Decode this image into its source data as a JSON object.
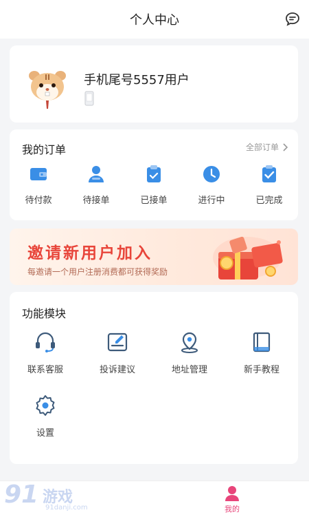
{
  "header": {
    "title": "个人中心",
    "message_icon": "chat-bubble-icon"
  },
  "profile": {
    "username": "手机尾号5557用户",
    "avatar_icon": "hamster-avatar",
    "phone_icon": "phone-icon"
  },
  "orders": {
    "title": "我的订单",
    "view_all": "全部订单",
    "accent": "#3a8ee6",
    "items": [
      {
        "label": "待付款",
        "icon": "wallet-icon"
      },
      {
        "label": "待接单",
        "icon": "user-icon"
      },
      {
        "label": "已接单",
        "icon": "clipboard-icon"
      },
      {
        "label": "进行中",
        "icon": "clock-icon"
      },
      {
        "label": "已完成",
        "icon": "checklist-icon"
      }
    ]
  },
  "banner": {
    "title": "邀请新用户加入",
    "subtitle": "每邀请一个用户注册消费都可获得奖励",
    "title_color": "#e8453a"
  },
  "modules": {
    "title": "功能模块",
    "items": [
      {
        "label": "联系客服",
        "icon": "headset-icon"
      },
      {
        "label": "投诉建议",
        "icon": "edit-icon"
      },
      {
        "label": "地址管理",
        "icon": "location-icon"
      },
      {
        "label": "新手教程",
        "icon": "book-icon"
      },
      {
        "label": "设置",
        "icon": "gear-icon"
      }
    ]
  },
  "tabbar": {
    "mine_label": "我的",
    "active_color": "#e8457a"
  },
  "watermark": {
    "big": "91",
    "cn": "游戏",
    "url": "91danji.com"
  }
}
